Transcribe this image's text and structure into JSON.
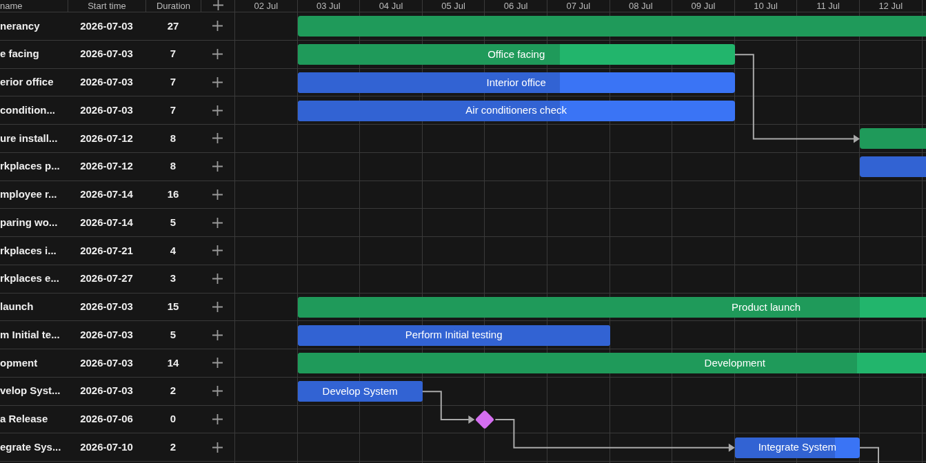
{
  "grid": {
    "columns": [
      {
        "label": "name"
      },
      {
        "label": "Start time"
      },
      {
        "label": "Duration"
      }
    ]
  },
  "timeline": {
    "days": [
      "02 Jul",
      "03 Jul",
      "04 Jul",
      "05 Jul",
      "06 Jul",
      "07 Jul",
      "08 Jul",
      "09 Jul",
      "10 Jul",
      "11 Jul",
      "12 Jul"
    ]
  },
  "tasks": [
    {
      "name": "nerancy",
      "start_time": "2026-07-03",
      "duration": "27",
      "kind": "project"
    },
    {
      "name": "e facing",
      "start_time": "2026-07-03",
      "duration": "7",
      "kind": "project",
      "level": 0.6,
      "bar_label": "Office facing",
      "link_out": true
    },
    {
      "name": "erior office",
      "start_time": "2026-07-03",
      "duration": "7",
      "kind": "task",
      "level": 0.6,
      "bar_label": "Interior office"
    },
    {
      "name": "condition...",
      "start_time": "2026-07-03",
      "duration": "7",
      "kind": "task",
      "level": 0.6,
      "bar_label": "Air conditioners check"
    },
    {
      "name": "ure install...",
      "start_time": "2026-07-12",
      "duration": "8",
      "kind": "project",
      "link_in": true
    },
    {
      "name": "rkplaces p...",
      "start_time": "2026-07-12",
      "duration": "8",
      "kind": "task"
    },
    {
      "name": "mployee r...",
      "start_time": "2026-07-14",
      "duration": "16",
      "kind": "project"
    },
    {
      "name": "paring wo...",
      "start_time": "2026-07-14",
      "duration": "5",
      "kind": "task"
    },
    {
      "name": "rkplaces i...",
      "start_time": "2026-07-21",
      "duration": "4",
      "kind": "task"
    },
    {
      "name": "rkplaces e...",
      "start_time": "2026-07-27",
      "duration": "3",
      "kind": "task"
    },
    {
      "name": "launch",
      "start_time": "2026-07-03",
      "duration": "15",
      "kind": "project",
      "level": 0.6,
      "bar_label": "Product launch"
    },
    {
      "name": "m Initial te...",
      "start_time": "2026-07-03",
      "duration": "5",
      "kind": "task",
      "level": 1,
      "bar_label": "Perform Initial testing"
    },
    {
      "name": "opment",
      "start_time": "2026-07-03",
      "duration": "14",
      "kind": "project",
      "level": 0.64,
      "bar_label": "Development"
    },
    {
      "name": "velop Syst...",
      "start_time": "2026-07-03",
      "duration": "2",
      "kind": "task",
      "level": 1,
      "bar_label": "Develop System",
      "link_out": true
    },
    {
      "name": "a Release",
      "start_time": "2026-07-06",
      "duration": "0",
      "kind": "milestone",
      "link_in": true,
      "link_out": true
    },
    {
      "name": "egrate Sys...",
      "start_time": "2026-07-10",
      "duration": "2",
      "kind": "task",
      "level": 0.8,
      "bar_label": "Integrate System",
      "link_in": true,
      "link_out": true
    }
  ]
}
